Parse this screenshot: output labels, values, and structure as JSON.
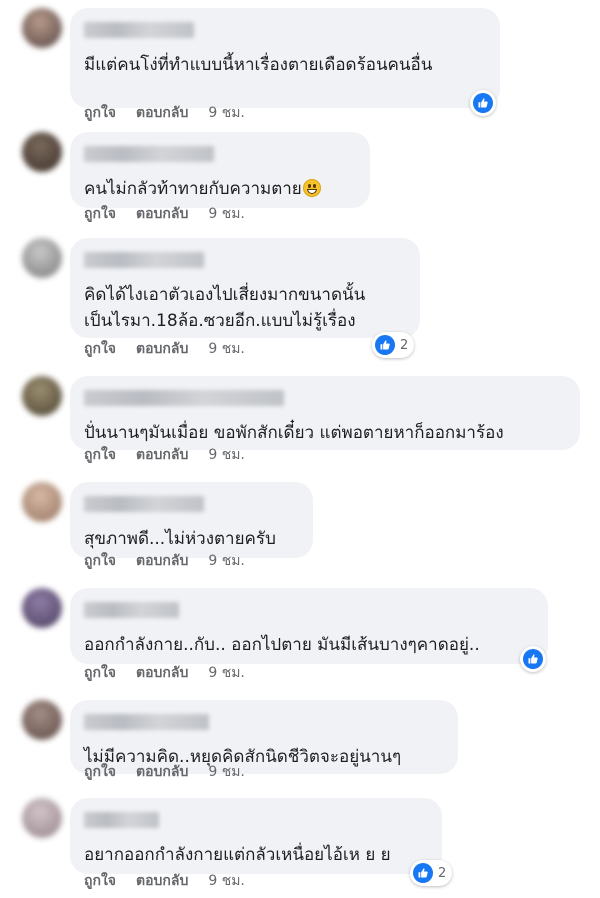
{
  "comments": [
    {
      "text": [
        "มีแต่คนโง่ที่ทำแบบนี้หาเรื่องตายเดือดร้อนคนอื่น"
      ],
      "has_emoji": false,
      "reaction": {
        "icon": "like-icon",
        "count": ""
      },
      "actions": {
        "like": "ถูกใจ",
        "reply": "ตอบกลับ",
        "time": "9 ชม."
      },
      "avatar_colors": [
        "#b89a8a",
        "#6d5a55"
      ]
    },
    {
      "text": [
        "คนไม่กลัวท้าทายกับความตาย"
      ],
      "has_emoji": true,
      "emoji_icon": "grinning-face-icon",
      "reaction": null,
      "actions": {
        "like": "ถูกใจ",
        "reply": "ตอบกลับ",
        "time": "9 ชม."
      },
      "avatar_colors": [
        "#7a6a5c",
        "#4a3d35"
      ]
    },
    {
      "text": [
        "คิดได้ไงเอาตัวเองไปเสี่ยงมากขนาดนั้น",
        "เป็นไรมา.18ล้อ.ซวยอีก.แบบไม่รู้เรื่อง"
      ],
      "has_emoji": false,
      "reaction": {
        "icon": "like-icon",
        "count": "2"
      },
      "actions": {
        "like": "ถูกใจ",
        "reply": "ตอบกลับ",
        "time": "9 ชม."
      },
      "avatar_colors": [
        "#c8c8c8",
        "#8d8d8d"
      ]
    },
    {
      "text": [
        "ปั่นนานๆมันเมื่อย ขอพักสักเดี๋ยว แต่พอตายหาก็ออกมาร้อง"
      ],
      "has_emoji": false,
      "reaction": null,
      "actions": {
        "like": "ถูกใจ",
        "reply": "ตอบกลับ",
        "time": "9 ชม."
      },
      "avatar_colors": [
        "#9b8e70",
        "#5e5440"
      ]
    },
    {
      "text": [
        "สุขภาพดี...ไม่ห่วงตายครับ"
      ],
      "has_emoji": false,
      "reaction": null,
      "actions": {
        "like": "ถูกใจ",
        "reply": "ตอบกลับ",
        "time": "9 ชม."
      },
      "avatar_colors": [
        "#d6b9a6",
        "#a68570"
      ]
    },
    {
      "text": [
        "ออกกำลังกาย..กับ.. ออกไปตาย มันมีเส้นบางๆคาดอยู่.."
      ],
      "has_emoji": false,
      "reaction": {
        "icon": "like-icon",
        "count": ""
      },
      "actions": {
        "like": "ถูกใจ",
        "reply": "ตอบกลับ",
        "time": "9 ชม."
      },
      "avatar_colors": [
        "#8e7da6",
        "#5b4d70"
      ]
    },
    {
      "text": [
        "ไม่มีความคิด..หยุดคิดสักนิดชีวิตจะอยู่นานๆ"
      ],
      "has_emoji": false,
      "reaction": null,
      "actions": {
        "like": "ถูกใจ",
        "reply": "ตอบกลับ",
        "time": "9 ชม."
      },
      "avatar_colors": [
        "#a48e86",
        "#6e5a55"
      ]
    },
    {
      "text": [
        "อยากออกกำลังกายแต่กลัวเหนื่อยไอ้เห ย ย"
      ],
      "has_emoji": false,
      "reaction": {
        "icon": "like-icon",
        "count": "2"
      },
      "actions": {
        "like": "ถูกใจ",
        "reply": "ตอบกลับ",
        "time": "9 ชม."
      },
      "avatar_colors": [
        "#d2c4c8",
        "#a3939a"
      ]
    }
  ]
}
